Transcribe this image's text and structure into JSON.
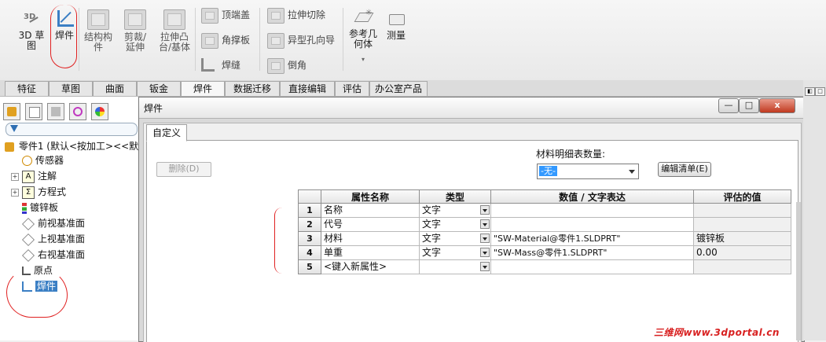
{
  "ribbon": {
    "sketch3d": "3D 草图",
    "weldments": "焊件",
    "structural_member": "结构构件",
    "trim_extend": "剪裁/延伸",
    "extruded_boss": "拉伸凸台/基体",
    "end_cap": "顶端盖",
    "gusset": "角撑板",
    "weld_bead": "焊缝",
    "extruded_cut": "拉伸切除",
    "hole_wizard": "异型孔向导",
    "chamfer": "倒角",
    "ref_geometry": "参考几何体",
    "measure": "测量"
  },
  "tabs": [
    "特征",
    "草图",
    "曲面",
    "钣金",
    "焊件",
    "数据迁移",
    "直接编辑",
    "评估",
    "办公室产品"
  ],
  "active_tab": "焊件",
  "tree": {
    "root": "零件1 (默认<按加工><<默",
    "items": [
      {
        "label": "传感器",
        "icon": "sensor-icon",
        "expandable": false
      },
      {
        "label": "注解",
        "icon": "annotation-icon",
        "expandable": true
      },
      {
        "label": "方程式",
        "icon": "equation-icon",
        "expandable": true
      },
      {
        "label": "镀锌板",
        "icon": "material-icon",
        "expandable": false
      },
      {
        "label": "前视基准面",
        "icon": "plane-icon",
        "expandable": false
      },
      {
        "label": "上视基准面",
        "icon": "plane-icon",
        "expandable": false
      },
      {
        "label": "右视基准面",
        "icon": "plane-icon",
        "expandable": false
      },
      {
        "label": "原点",
        "icon": "origin-icon",
        "expandable": false
      },
      {
        "label": "焊件",
        "icon": "weldment-icon",
        "expandable": false,
        "selected": true
      }
    ]
  },
  "dialog": {
    "title": "焊件",
    "minimize": "—",
    "maximize": "□",
    "close": "x",
    "tab": "自定义",
    "delete_button": "删除(D)",
    "bom_qty_label": "材料明细表数量:",
    "bom_qty_value": "-无-",
    "edit_list_button": "编辑清单(E)",
    "columns": [
      "属性名称",
      "类型",
      "数值 / 文字表达",
      "评估的值"
    ],
    "rows": [
      {
        "num": "1",
        "name": "名称",
        "type": "文字",
        "expr": "",
        "value": ""
      },
      {
        "num": "2",
        "name": "代号",
        "type": "文字",
        "expr": "",
        "value": ""
      },
      {
        "num": "3",
        "name": "材料",
        "type": "文字",
        "expr": "\"SW-Material@零件1.SLDPRT\"",
        "value": "镀锌板"
      },
      {
        "num": "4",
        "name": "单重",
        "type": "文字",
        "expr": "\"SW-Mass@零件1.SLDPRT\"",
        "value": "0.00"
      },
      {
        "num": "5",
        "name": "<键入新属性>",
        "type": "",
        "expr": "",
        "value": ""
      }
    ]
  },
  "watermark": "三维网www.3dportal.cn",
  "colors": {
    "selection": "#3b7fc4",
    "annotation_red": "#e02020",
    "close_red": "#c0391f"
  }
}
